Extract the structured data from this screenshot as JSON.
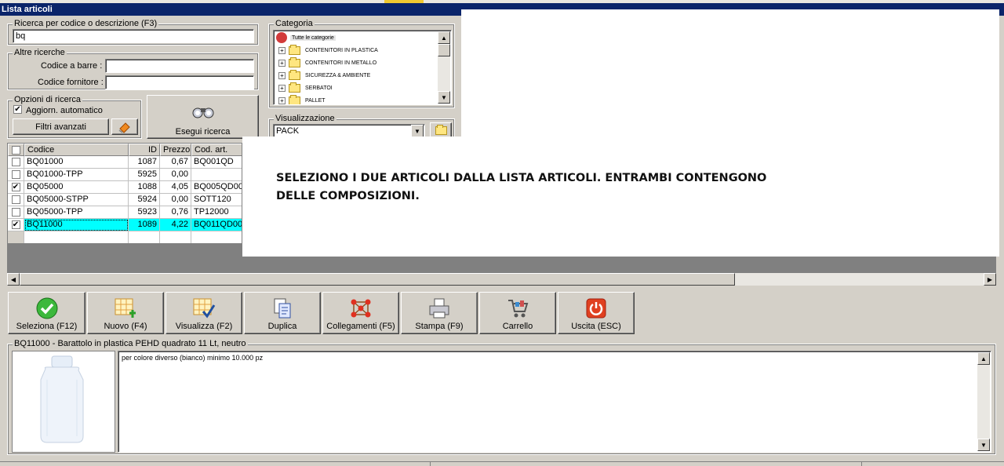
{
  "window": {
    "title": "Lista articoli"
  },
  "search": {
    "group_label": "Ricerca per codice o descrizione (F3)",
    "value": "bq"
  },
  "other_search": {
    "group_label": "Altre ricerche",
    "barcode_label": "Codice a barre :",
    "barcode_value": "",
    "supplier_label": "Codice fornitore :",
    "supplier_value": ""
  },
  "options": {
    "group_label": "Opzioni di ricerca",
    "auto_update_label": "Aggiorn. automatico",
    "auto_update_checked": true,
    "advanced_filters_label": "Filtri avanzati",
    "run_search_label": "Esegui ricerca"
  },
  "category": {
    "group_label": "Categoria",
    "root_label": "Tutte le categorie",
    "items": [
      "CONTENITORI IN PLASTICA",
      "CONTENITORI IN METALLO",
      "SICUREZZA & AMBIENTE",
      "SERBATOI",
      "PALLET"
    ]
  },
  "view": {
    "group_label": "Visualizzazione",
    "selected": "PACK"
  },
  "grid": {
    "headers": {
      "code": "Codice",
      "id": "ID",
      "price": "Prezzo",
      "art_code": "Cod. art."
    },
    "rows": [
      {
        "checked": "",
        "code": "BQ01000",
        "id": "1087",
        "price": "0,67",
        "art_code": "BQ001QD"
      },
      {
        "checked": "",
        "code": "BQ01000-TPP",
        "id": "5925",
        "price": "0,00",
        "art_code": ""
      },
      {
        "checked": "✔",
        "code": "BQ05000",
        "id": "1088",
        "price": "4,05",
        "art_code": "BQ005QD00"
      },
      {
        "checked": "",
        "code": "BQ05000-STPP",
        "id": "5924",
        "price": "0,00",
        "art_code": "SOTT120"
      },
      {
        "checked": "",
        "code": "BQ05000-TPP",
        "id": "5923",
        "price": "0,76",
        "art_code": "TP12000"
      },
      {
        "checked": "✔",
        "code": "BQ11000",
        "id": "1089",
        "price": "4,22",
        "art_code": "BQ011QD00"
      }
    ]
  },
  "toolbar": {
    "select": "Seleziona (F12)",
    "new": "Nuovo (F4)",
    "view": "Visualizza (F2)",
    "duplicate": "Duplica",
    "links": "Collegamenti (F5)",
    "print": "Stampa (F9)",
    "cart": "Carrello",
    "exit": "Uscita (ESC)"
  },
  "detail": {
    "group_label": "BQ11000 - Barattolo in plastica PEHD quadrato 11 Lt, neutro",
    "notes": "per colore diverso (bianco) minimo 10.000 pz"
  },
  "annotation": {
    "line1": "SELEZIONO I DUE ARTICOLI DALLA LISTA ARTICOLI. ENTRAMBI CONTENGONO",
    "line2": "DELLE COMPOSIZIONI."
  }
}
